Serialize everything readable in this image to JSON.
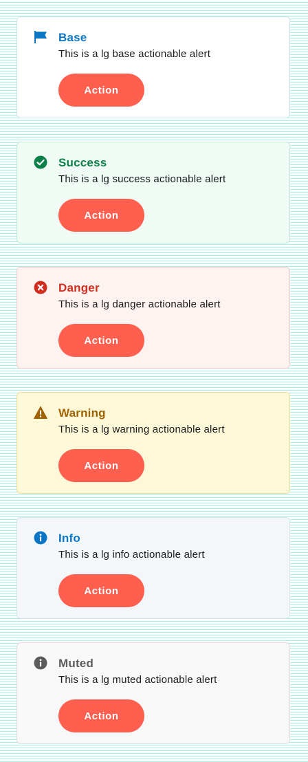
{
  "alerts": [
    {
      "title": "Base",
      "message": "This is a lg base actionable alert",
      "action": "Action",
      "icon": "flag-icon",
      "accent": "#0b76c5",
      "bg": "#ffffff",
      "border": "#cfe4ea"
    },
    {
      "title": "Success",
      "message": "This is a lg success actionable alert",
      "action": "Action",
      "icon": "check-circle-icon",
      "accent": "#0b7f48",
      "bg": "#effbf4",
      "border": "#bfe9d2"
    },
    {
      "title": "Danger",
      "message": "This is a lg danger actionable alert",
      "action": "Action",
      "icon": "error-circle-icon",
      "accent": "#d12e1e",
      "bg": "#fff3f2",
      "border": "#f2cfcb"
    },
    {
      "title": "Warning",
      "message": "This is a lg warning actionable alert",
      "action": "Action",
      "icon": "warning-triangle-icon",
      "accent": "#a16200",
      "bg": "#fdf9d8",
      "border": "#ece19a"
    },
    {
      "title": "Info",
      "message": "This is a lg info actionable alert",
      "action": "Action",
      "icon": "info-circle-icon",
      "accent": "#0b76c5",
      "bg": "#f3f7fa",
      "border": "#d4e2ec"
    },
    {
      "title": "Muted",
      "message": "This is a lg muted actionable alert",
      "action": "Action",
      "icon": "muted-info-circle-icon",
      "accent": "#5c5c5c",
      "bg": "#f8f8f8",
      "border": "#dedede"
    }
  ],
  "action_color": "#ff5f4f"
}
